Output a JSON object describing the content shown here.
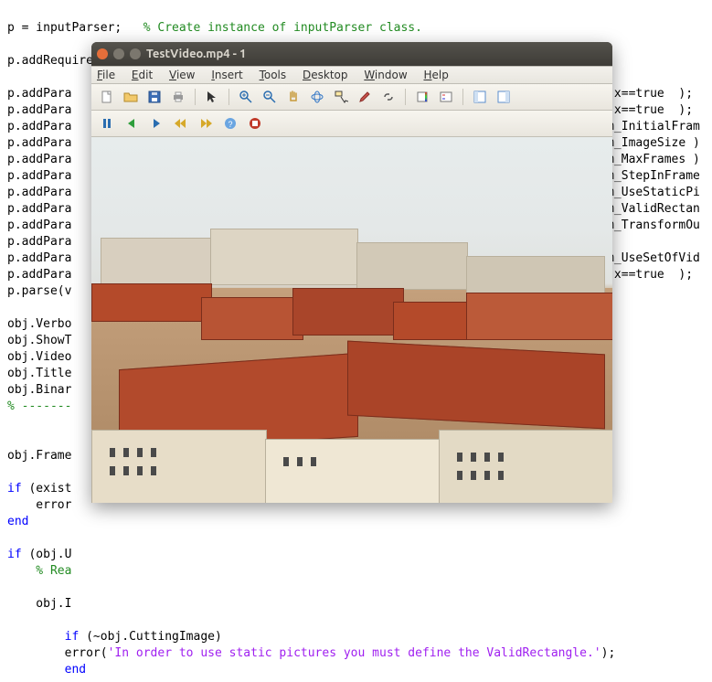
{
  "editor": {
    "l01a": "p = inputParser;   ",
    "l01c": "% Create instance of inputParser class.",
    "l02": "",
    "l03": "p.addRequired( 'videoName' );",
    "l04": "",
    "l05a": "p.addPara",
    "l05b": "|| x==true  );",
    "l06a": "p.addPara",
    "l06b": "|| x==true  );",
    "l07a": "p.addPara",
    "l07b": "ram_InitialFram",
    "l08a": "p.addPara",
    "l08b": "ram_ImageSize )",
    "l09a": "p.addPara",
    "l09b": "ram_MaxFrames )",
    "l10a": "p.addPara",
    "l10b": "ram_StepInFrame",
    "l11a": "p.addPara",
    "l11b": "ram_UseStaticPi",
    "l12a": "p.addPara",
    "l12b": "ram_ValidRectan",
    "l13a": "p.addPara",
    "l13b": "ram_TransformOu",
    "l14a": "p.addPara",
    "l15a": "p.addPara",
    "l15b": "ram_UseSetOfVid",
    "l16a": "p.addPara",
    "l16b": "|| x==true  );",
    "l17": "p.parse(v",
    "l18": "",
    "l19": "obj.Verbo",
    "l20": "obj.ShowT",
    "l21": "obj.Video",
    "l22": "obj.Title",
    "l23": "obj.Binar",
    "l24": "% -------",
    "l25": "",
    "l26": "",
    "l27": "obj.Frame",
    "l28": "",
    "l29a": "if ",
    "l29b": "(exist",
    "l30": "    error",
    "l31": "end",
    "l32": "",
    "l33a": "if ",
    "l33b": "(obj.U",
    "l34": "    % Rea",
    "l35": "",
    "l36": "    obj.I",
    "l37": "",
    "l38a": "    if ",
    "l38b": "(~obj.CuttingImage)",
    "l39a": "        error(",
    "l39b": "'In order to use static pictures you must define the ValidRectangle.'",
    "l39c": ");",
    "l40": "    end"
  },
  "figure": {
    "title": "TestVideo.mp4 - 1",
    "menu": {
      "file": "File",
      "edit": "Edit",
      "view": "View",
      "insert": "Insert",
      "tools": "Tools",
      "desktop": "Desktop",
      "window": "Window",
      "help": "Help"
    }
  },
  "icons": {
    "new": "new-file-icon",
    "open": "open-folder-icon",
    "save": "save-icon",
    "print": "print-icon",
    "arrow": "pointer-icon",
    "zoomin": "zoom-in-icon",
    "zoomout": "zoom-out-icon",
    "pan": "pan-icon",
    "rotate": "rotate-3d-icon",
    "datacursor": "data-cursor-icon",
    "brush": "brush-icon",
    "link": "link-icon",
    "colorbar": "colorbar-icon",
    "legend": "legend-icon",
    "plottools": "plot-tools-icon",
    "play": "play-icon",
    "step": "step-icon",
    "pause": "pause-icon",
    "first": "first-frame-icon",
    "last": "last-frame-icon",
    "help": "help-icon",
    "stop": "stop-icon"
  }
}
